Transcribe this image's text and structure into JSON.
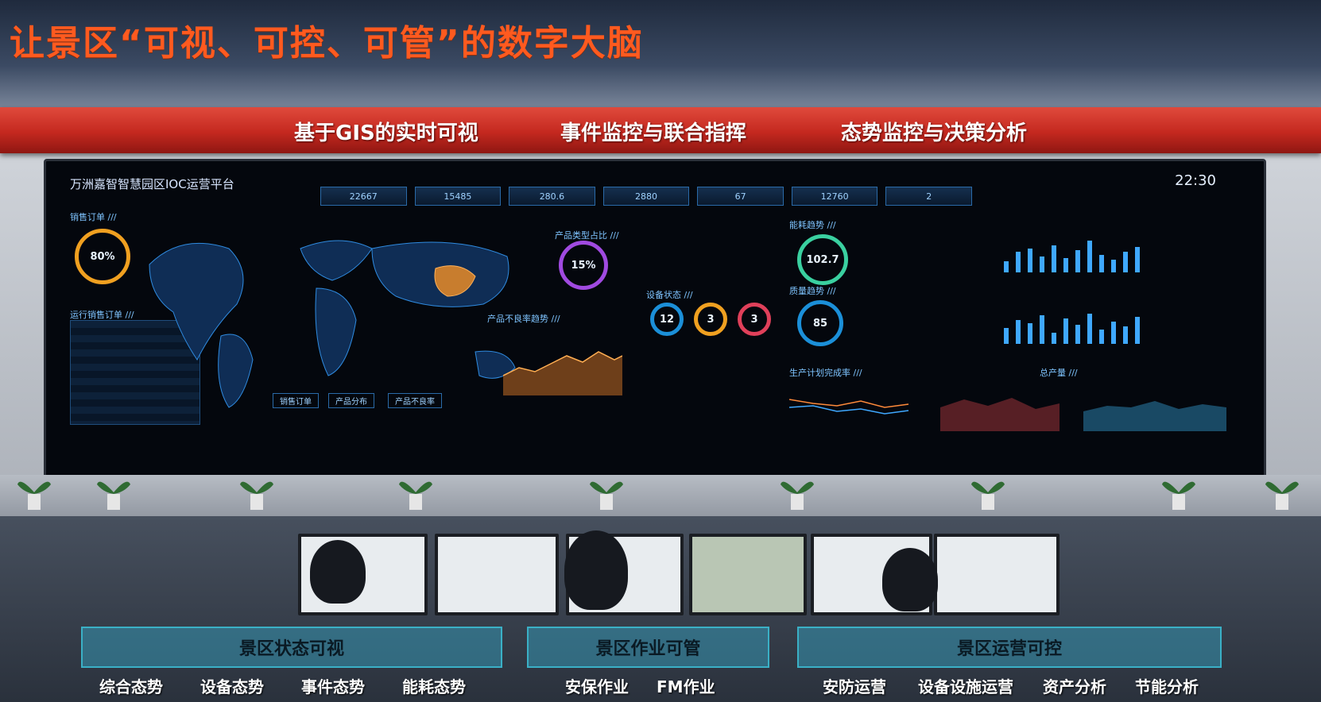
{
  "title": "让景区“可视、可控、可管”的数字大脑",
  "band": {
    "item1": "基于GIS的实时可视",
    "item2": "事件监控与联合指挥",
    "item3": "态势监控与决策分析"
  },
  "screen": {
    "platform_title": "万洲嘉智智慧园区IOC运营平台",
    "time": "22:30",
    "kpis": [
      "22667",
      "15485",
      "280.6",
      "2880",
      "67",
      "12760",
      "2"
    ],
    "labels": {
      "sales_orders": "销售订单 ///",
      "running_sales": "运行销售订单 ///",
      "product_type_ratio": "产品类型占比 ///",
      "defect_trend": "产品不良率趋势 ///",
      "device_status": "设备状态 ///",
      "energy": "能耗趋势 ///",
      "quality": "质量趋势 ///",
      "production_plan": "生产计划完成率 ///",
      "total_output": "总产量 ///"
    },
    "gauges": {
      "sales": "80%",
      "product": "15%",
      "energy": "102.7",
      "quality": "85",
      "dev1": "12",
      "dev2": "3",
      "dev3": "3"
    },
    "map_buttons": [
      "销售订单",
      "产品分布",
      "产品不良率"
    ]
  },
  "groups": [
    {
      "title": "景区状态可视",
      "subs": [
        "综合态势",
        "设备态势",
        "事件态势",
        "能耗态势"
      ]
    },
    {
      "title": "景区作业可管",
      "subs": [
        "安保作业",
        "FM作业"
      ]
    },
    {
      "title": "景区运营可控",
      "subs": [
        "安防运营",
        "设备设施运营",
        "资产分析",
        "节能分析"
      ]
    }
  ],
  "colors": {
    "title": "#ff5a1f",
    "band": "#c4281f",
    "group_box": "#3496b2",
    "screen_accent": "#3fa8ff"
  }
}
